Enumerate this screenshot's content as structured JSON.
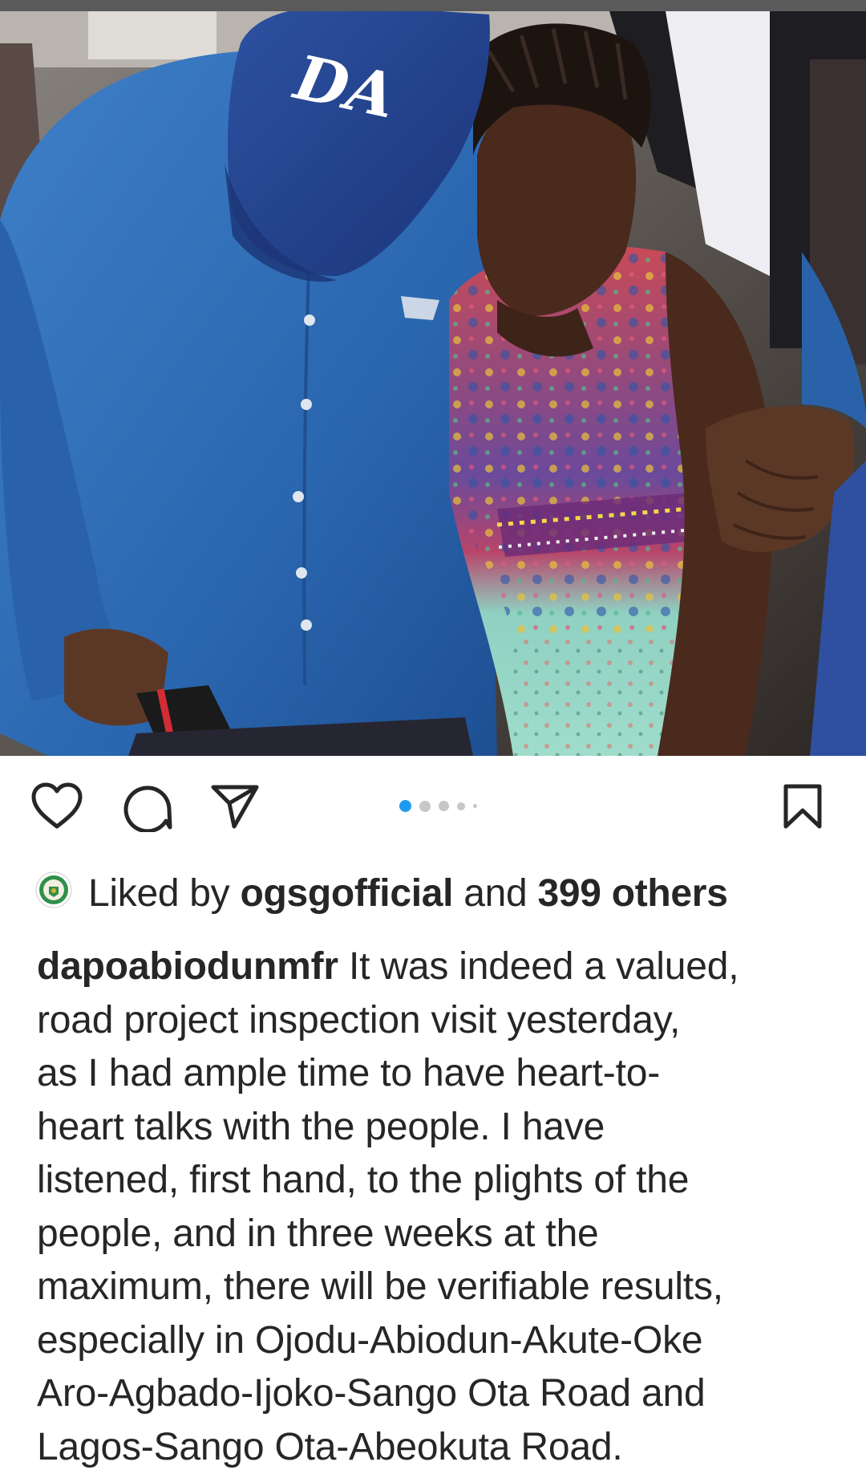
{
  "post": {
    "photo": {
      "alt_subject": "man in blue denim shirt and DA cap embracing a crying woman",
      "cap_text": "DA"
    },
    "actions": {
      "like_icon": "heart-icon",
      "comment_icon": "comment-icon",
      "share_icon": "paper-plane-icon",
      "save_icon": "bookmark-icon"
    },
    "carousel": {
      "total": 5,
      "active_index": 0
    },
    "likes": {
      "prefix": "Liked by",
      "liker": "ogsgofficial",
      "connector": "and",
      "others": "399 others"
    },
    "caption": {
      "username": "dapoabiodunmfr",
      "first_line_text": "It was indeed a valued,",
      "lines": [
        "road project inspection visit yesterday,",
        "as I had ample time to have heart-to-",
        "heart talks with the people. I have",
        "listened, first hand, to the plights of the",
        "people, and in three weeks at the",
        "maximum, there will be verifiable results,",
        "especially in Ojodu-Abiodun-Akute-Oke",
        "Aro-Agbado-Ijoko-Sango Ota Road and",
        "Lagos-Sango Ota-Abeokuta Road."
      ]
    },
    "colors": {
      "text": "#262626",
      "carousel_active": "#1d9bf0",
      "carousel_inactive": "#c7c7c7",
      "shirt_blue": "#2f6db4",
      "cap_navy": "#23418a"
    }
  }
}
